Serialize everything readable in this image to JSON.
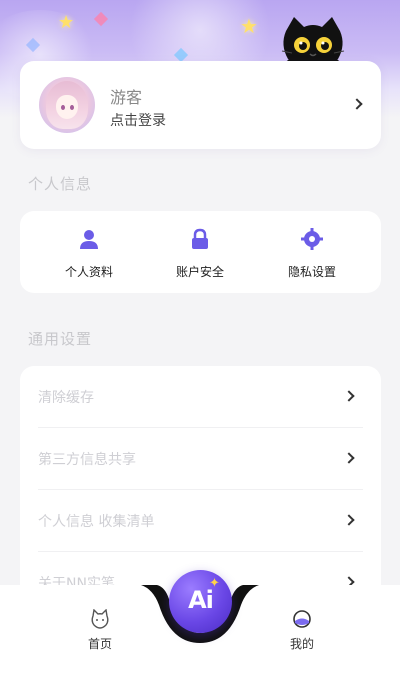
{
  "profile": {
    "name": "游客",
    "subtitle": "点击登录"
  },
  "personal_info": {
    "section_title": "个人信息",
    "items": [
      {
        "label": "个人资料",
        "icon": "user-icon"
      },
      {
        "label": "账户安全",
        "icon": "lock-icon"
      },
      {
        "label": "隐私设置",
        "icon": "gear-icon"
      }
    ]
  },
  "general_settings": {
    "section_title": "通用设置",
    "rows": [
      {
        "label": "清除缓存"
      },
      {
        "label": "第三方信息共享"
      },
      {
        "label": "个人信息 收集清单"
      },
      {
        "label": "关于NN实笔"
      }
    ]
  },
  "tabbar": {
    "home_label": "首页",
    "ai_label": "Ai",
    "mine_label": "我的"
  },
  "colors": {
    "accent": "#5b3fd8",
    "header_gradient_top": "#b9a6f1",
    "background": "#f4f4f6",
    "icon_purple": "#6b5ce7"
  }
}
